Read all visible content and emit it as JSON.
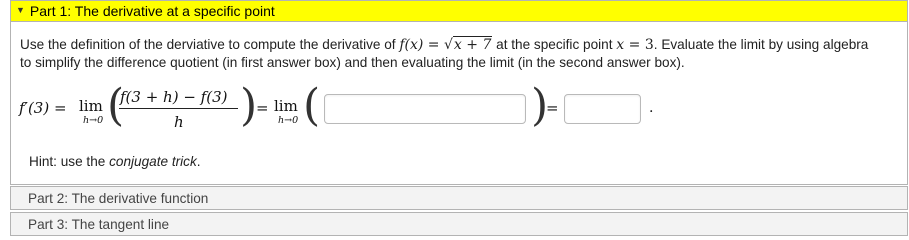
{
  "part1": {
    "title": "Part 1: The derivative at a specific point",
    "problem": {
      "intro": "Use the definition of the derviative to compute the derivative of ",
      "func_lhs": "f(x)",
      "func_eq": " = ",
      "sqrt_body": "x + 7",
      "mid": " at the specific point ",
      "point_var": "x",
      "point_eq": " = ",
      "point_val": "3",
      "tail": ". Evaluate the limit by using algebra to simplify the difference quotient (in first answer box) and then evaluating the limit (in the second answer box)."
    },
    "equation": {
      "lhs": "f′(3) =",
      "lim1": "lim",
      "lim1_sub": "h→0",
      "numerator": "f(3 + h) − f(3)",
      "denominator": "h",
      "eq2": "=",
      "lim2": "lim",
      "lim2_sub": "h→0",
      "eq3": "=",
      "period": "."
    },
    "answer1": {
      "value": ""
    },
    "answer2": {
      "value": ""
    },
    "hint": {
      "prefix": "Hint: use the ",
      "emph": "conjugate trick",
      "suffix": "."
    }
  },
  "part2": {
    "title": "Part 2: The derivative function"
  },
  "part3": {
    "title": "Part 3: The tangent line"
  },
  "colors": {
    "active_header": "#ffff00",
    "collapsed_bg": "#f3f3f3",
    "border": "#b3b3b3"
  },
  "icons": {
    "expand_caret": "caret-down-icon"
  }
}
